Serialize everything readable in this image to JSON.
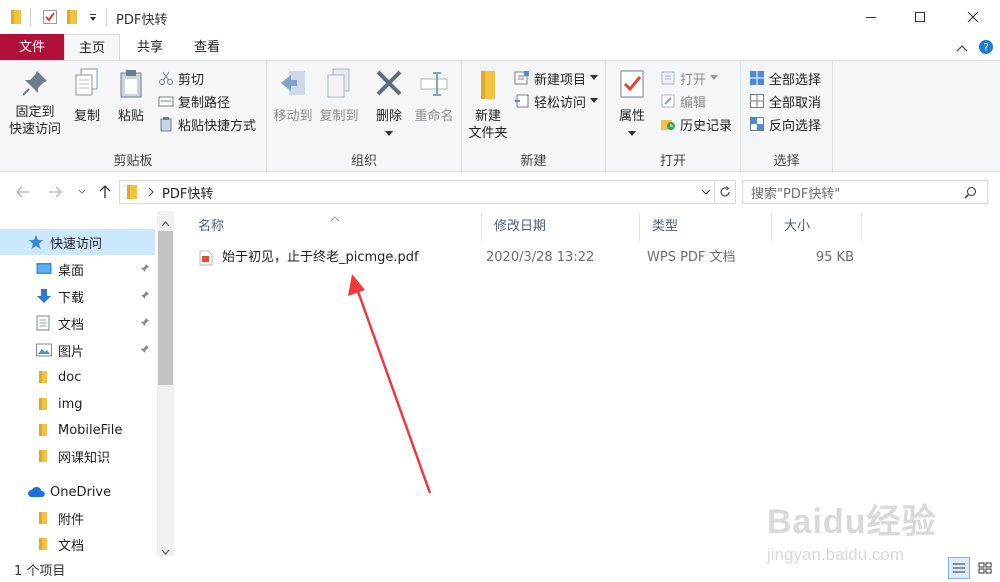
{
  "window": {
    "title": "PDF快转"
  },
  "tabs": [
    {
      "label": "文件"
    },
    {
      "label": "主页"
    },
    {
      "label": "共享"
    },
    {
      "label": "查看"
    }
  ],
  "ribbon": {
    "clipboard": {
      "group_label": "剪贴板",
      "pin_quick_line1": "固定到",
      "pin_quick_line2": "快速访问",
      "copy": "复制",
      "paste": "粘贴",
      "cut": "剪切",
      "copy_path": "复制路径",
      "paste_shortcut": "粘贴快捷方式"
    },
    "organize": {
      "group_label": "组织",
      "move_to": "移动到",
      "copy_to": "复制到",
      "delete": "删除",
      "rename": "重命名"
    },
    "new": {
      "group_label": "新建",
      "new_folder_line1": "新建",
      "new_folder_line2": "文件夹",
      "new_item": "新建项目",
      "easy_access": "轻松访问"
    },
    "open": {
      "group_label": "打开",
      "properties": "属性",
      "open": "打开",
      "edit": "编辑",
      "history": "历史记录"
    },
    "select": {
      "group_label": "选择",
      "select_all": "全部选择",
      "select_none": "全部取消",
      "invert": "反向选择"
    }
  },
  "address": {
    "path": "PDF快转",
    "search_placeholder": "搜索\"PDF快转\""
  },
  "nav": {
    "quick_access": "快速访问",
    "items": [
      {
        "label": "桌面"
      },
      {
        "label": "下载"
      },
      {
        "label": "文档"
      },
      {
        "label": "图片"
      },
      {
        "label": "doc"
      },
      {
        "label": "img"
      },
      {
        "label": "MobileFile"
      },
      {
        "label": "网课知识"
      }
    ],
    "onedrive": "OneDrive",
    "onedrive_items": [
      {
        "label": "附件"
      },
      {
        "label": "文档"
      }
    ]
  },
  "columns": {
    "name": "名称",
    "date": "修改日期",
    "type": "类型",
    "size": "大小"
  },
  "files": [
    {
      "name": "始于初见，止于终老_picmge.pdf",
      "date": "2020/3/28 13:22",
      "type": "WPS PDF 文档",
      "size": "95 KB"
    }
  ],
  "status": {
    "count": "1 个项目"
  },
  "watermark": {
    "brand": "Baidu经验",
    "url": "jingyan.baidu.com"
  },
  "colors": {
    "file_tab": "#b0103a",
    "selection": "#cce8ff",
    "annotation_arrow": "#f0393c",
    "folder": "#f4c243"
  }
}
